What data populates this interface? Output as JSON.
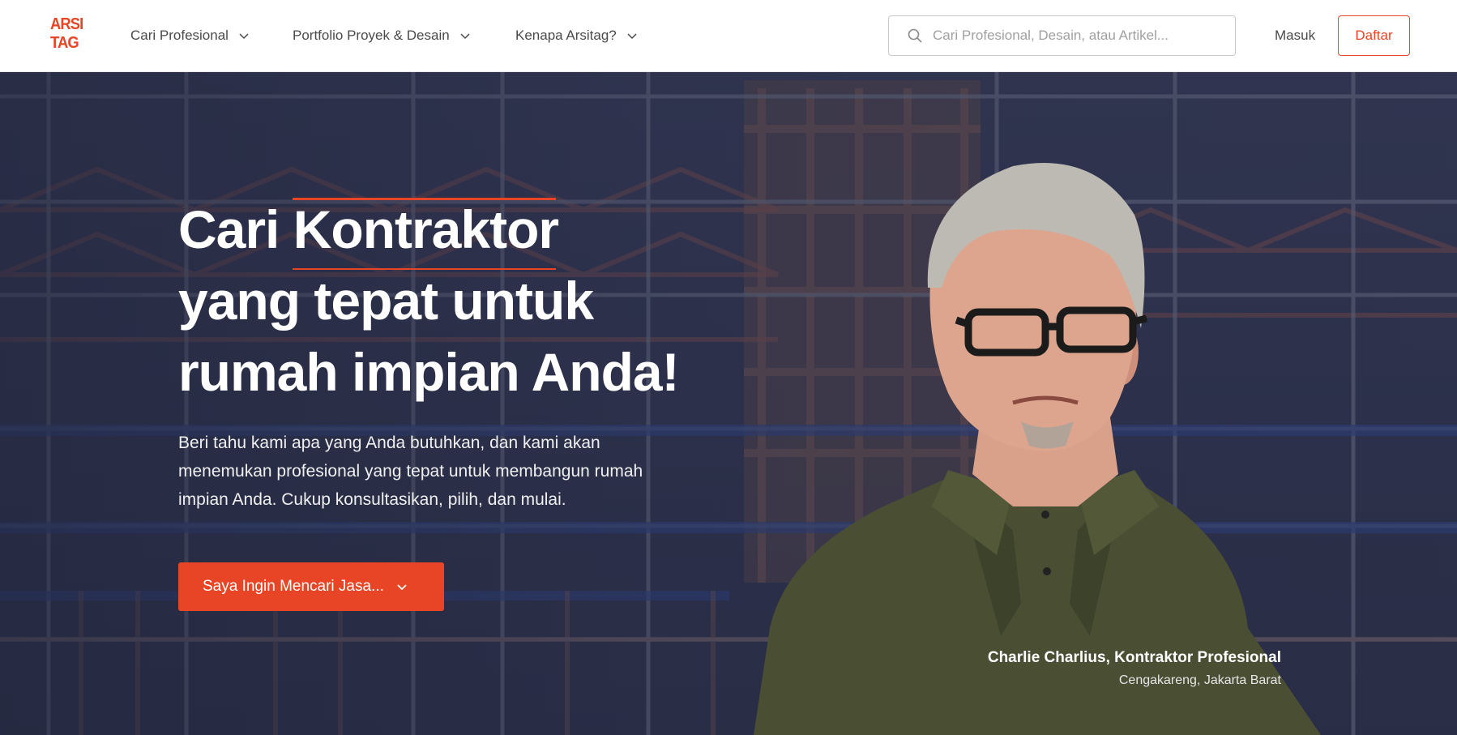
{
  "brand": {
    "logo_line1": "ARSI",
    "logo_line2": "TAG",
    "accent_color": "#e84426"
  },
  "nav": {
    "items": [
      {
        "label": "Cari Profesional",
        "icon": "chevron-down-icon"
      },
      {
        "label": "Portfolio Proyek & Desain",
        "icon": "chevron-down-icon"
      },
      {
        "label": "Kenapa Arsitag?",
        "icon": "chevron-down-icon"
      }
    ]
  },
  "search": {
    "placeholder": "Cari Profesional, Desain, atau Artikel...",
    "value": "",
    "icon": "search-icon"
  },
  "auth": {
    "login_label": "Masuk",
    "register_label": "Daftar"
  },
  "hero": {
    "headline_line1": "Cari Kontraktor",
    "headline_line2": "yang tepat untuk",
    "headline_line3": "rumah impian Anda!",
    "subtext": "Beri tahu kami apa yang Anda butuhkan, dan kami akan menemukan profesional yang tepat untuk membangun rumah impian Anda. Cukup konsultasikan, pilih, dan mulai.",
    "cta_label": "Saya Ingin Mencari Jasa...",
    "cta_icon": "chevron-down-icon",
    "caption_name": "Charlie Charlius, Kontraktor Profesional",
    "caption_location": "Cengakareng, Jakarta Barat"
  }
}
